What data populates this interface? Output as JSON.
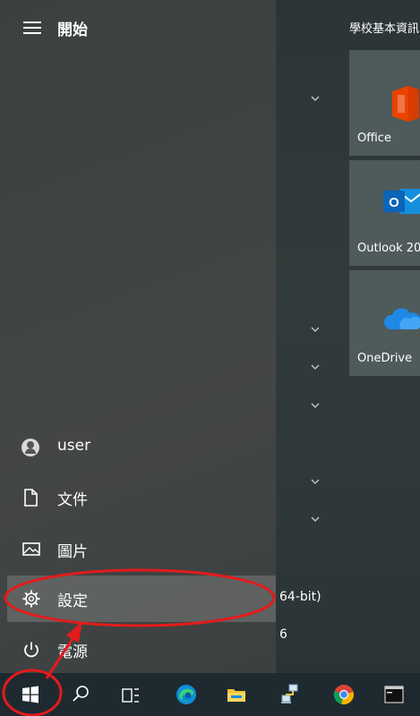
{
  "start_menu": {
    "title": "開始",
    "items": [
      {
        "name": "user",
        "label": "user",
        "icon": "user-avatar-icon"
      },
      {
        "name": "documents",
        "label": "文件",
        "icon": "document-icon"
      },
      {
        "name": "pictures",
        "label": "圖片",
        "icon": "picture-icon"
      },
      {
        "name": "settings",
        "label": "設定",
        "icon": "gear-icon"
      },
      {
        "name": "power",
        "label": "電源",
        "icon": "power-icon"
      }
    ]
  },
  "app_list": {
    "partial_texts": [
      "64-bit)",
      "6"
    ]
  },
  "tiles": {
    "group_title": "學校基本資訊",
    "items": [
      {
        "label": "Office",
        "icon": "office-icon"
      },
      {
        "label": "Outlook 20",
        "icon": "outlook-icon"
      },
      {
        "label": "OneDrive",
        "icon": "onedrive-icon"
      }
    ]
  },
  "taskbar": {
    "items": [
      "windows-start-icon",
      "search-icon",
      "task-view-icon",
      "edge-icon",
      "file-explorer-icon",
      "network-app-icon",
      "chrome-icon",
      "terminal-icon"
    ]
  },
  "colors": {
    "annotation_red": "#e31b1b",
    "office_red": "#d83b01",
    "outlook_blue": "#0a64b8",
    "onedrive_blue": "#1e88e5"
  }
}
